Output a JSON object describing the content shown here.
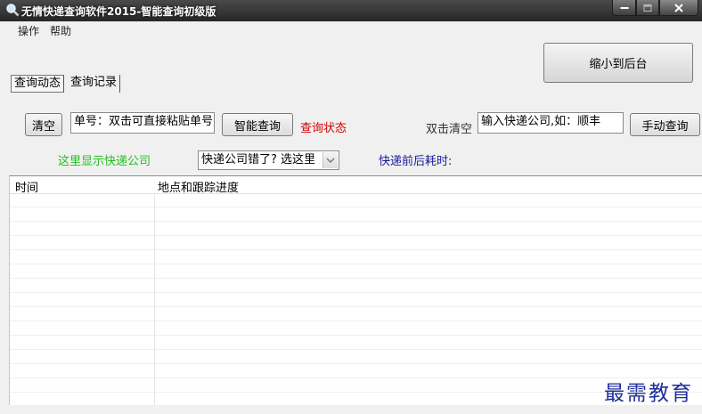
{
  "window": {
    "title": "无情快递查询软件2015-智能查询初级版"
  },
  "menu": {
    "items": [
      "操作",
      "帮助"
    ]
  },
  "toolbar": {
    "minimize_to_tray": "缩小到后台"
  },
  "tabs": [
    "查询动态",
    "查询记录"
  ],
  "query": {
    "clear_label": "清空",
    "tracking_value": "单号：双击可直接粘贴单号",
    "smart_query_label": "智能查询",
    "status_text": "查询状态",
    "double_click_clear": "双击清空",
    "company_input_value": "输入快递公司,如：顺丰",
    "manual_query_label": "手动查询"
  },
  "info": {
    "company_placeholder": "这里显示快递公司",
    "company_select_value": "快递公司错了? 选这里",
    "time_cost_label": "快递前后耗时:"
  },
  "table": {
    "columns": [
      "时间",
      "地点和跟踪进度"
    ],
    "rows": []
  },
  "watermark": "最需教育",
  "colors": {
    "status_red": "#d40000",
    "company_green": "#20c020",
    "timecost_blue": "#1a1a9c",
    "watermark_blue": "#1f2f9a"
  }
}
